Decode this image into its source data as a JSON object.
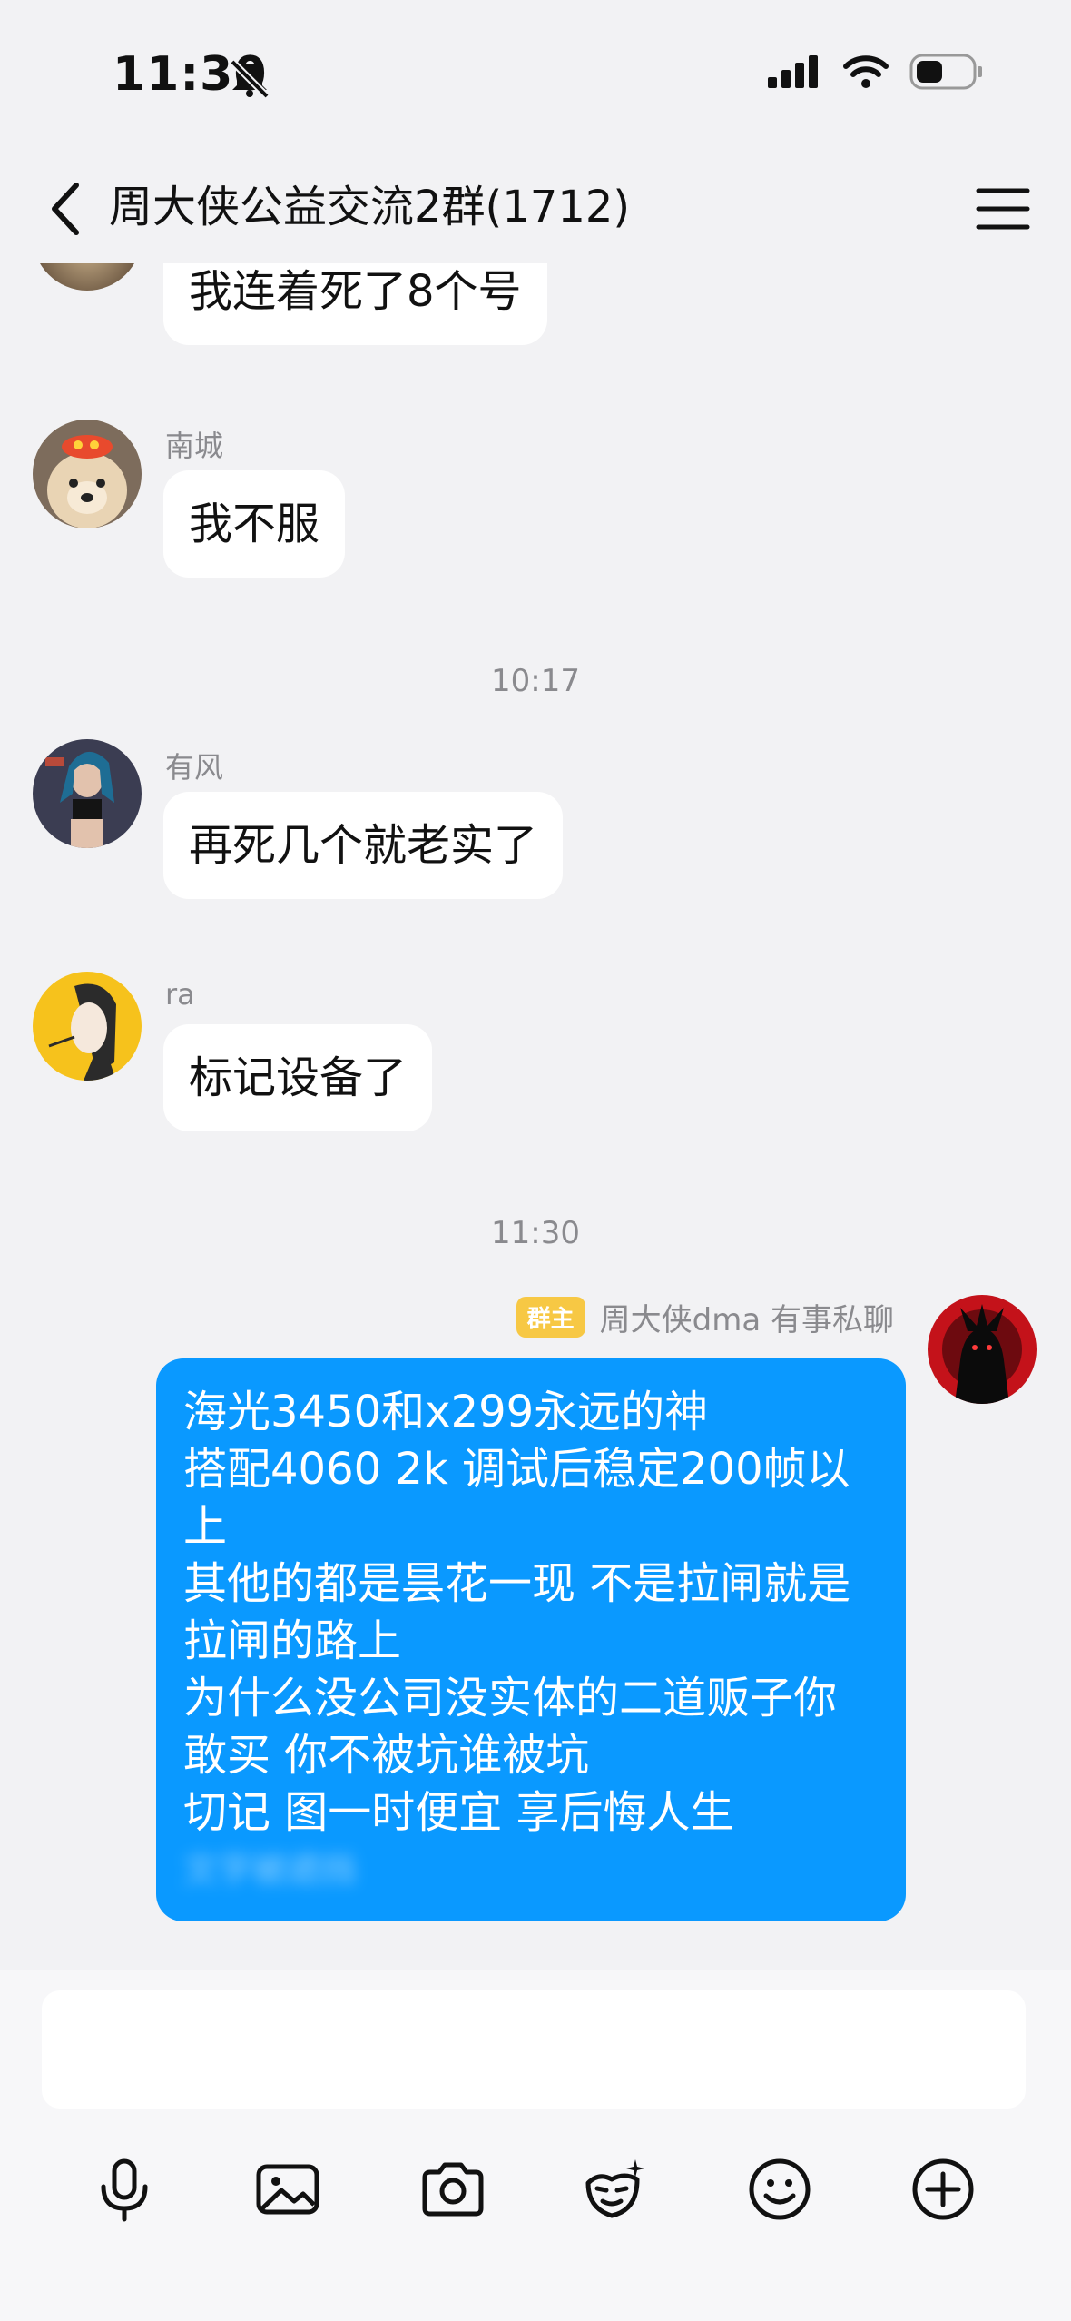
{
  "status_bar": {
    "time": "11:30"
  },
  "header": {
    "title": "周大侠公益交流2群(1712)"
  },
  "messages": [
    {
      "sender": "",
      "text": "我连着死了8个号"
    },
    {
      "sender": "南城",
      "text": "我不服"
    },
    {
      "timestamp": "10:17"
    },
    {
      "sender": "有风",
      "text": "再死几个就老实了"
    },
    {
      "sender": "ra",
      "text": "标记设备了"
    },
    {
      "timestamp": "11:30"
    },
    {
      "badge": "群主",
      "sender": "周大侠dma 有事私聊",
      "lines": [
        "海光3450和x299永远的神",
        "搭配4060 2k 调试后稳定200帧以上",
        "其他的都是昙花一现 不是拉闸就是拉闸的路上",
        "为什么没公司没实体的二道贩子你敢买 你不被坑谁被坑",
        "切记 图一时便宜 享后悔人生",
        "文字被遮挡"
      ]
    }
  ],
  "colors": {
    "accent": "#0a99ff",
    "owner_badge": "#f7c844",
    "background": "#f2f2f4"
  },
  "icons": [
    "back-icon",
    "menu-icon",
    "microphone-icon",
    "image-icon",
    "camera-icon",
    "sticker-icon",
    "emoji-icon",
    "plus-icon"
  ]
}
